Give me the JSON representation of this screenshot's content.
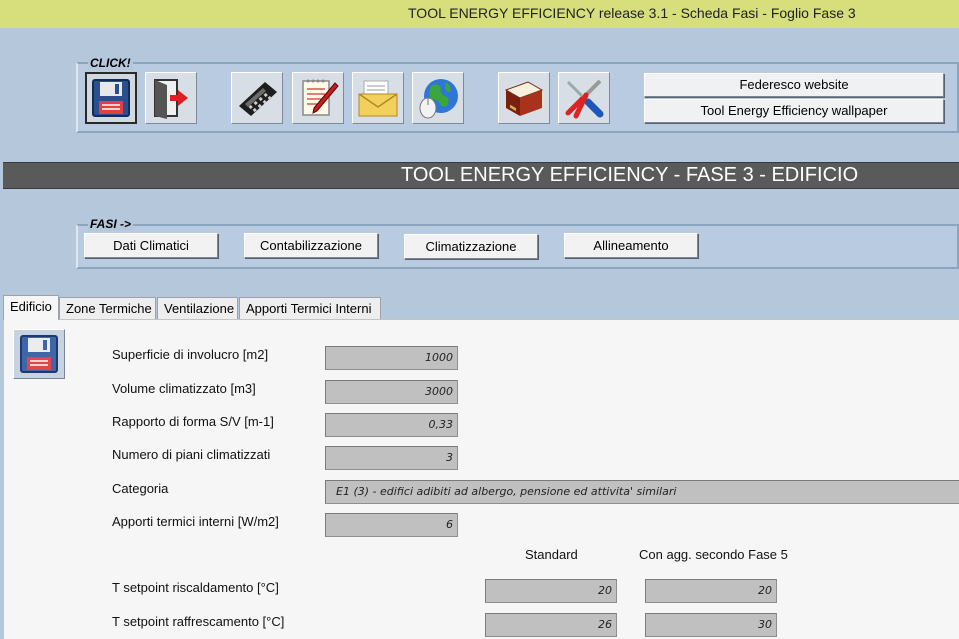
{
  "window": {
    "title": "TOOL ENERGY EFFICIENCY release 3.1 - Scheda Fasi - Foglio Fase 3"
  },
  "toolbar": {
    "group_label": "CLICK!",
    "icons": {
      "save": "floppy-disk-icon",
      "exit": "exit-door-icon",
      "calculator": "calculator-icon",
      "notes": "notepad-pencil-icon",
      "mail": "envelope-icon",
      "web": "globe-mouse-icon",
      "book": "book-icon",
      "tools": "screwdriver-pliers-icon"
    },
    "federesco_label": "Federesco website",
    "wallpaper_label": "Tool Energy Efficiency wallpaper"
  },
  "banner": {
    "title": "TOOL ENERGY EFFICIENCY - FASE 3 - EDIFICIO"
  },
  "phases": {
    "group_label": "FASI ->",
    "buttons": [
      "Dati Climatici",
      "Contabilizzazione",
      "Climatizzazione",
      "Allineamento"
    ]
  },
  "tabs": [
    "Edificio",
    "Zone Termiche",
    "Ventilazione",
    "Apporti Termici Interni"
  ],
  "form": {
    "superficie": {
      "label": "Superficie di involucro [m2]",
      "value": "1000"
    },
    "volume": {
      "label": "Volume climatizzato [m3]",
      "value": "3000"
    },
    "rapporto": {
      "label": "Rapporto di forma S/V [m-1]",
      "value": "0,33"
    },
    "piani": {
      "label": "Numero di piani climatizzati",
      "value": "3"
    },
    "categoria": {
      "label": "Categoria",
      "value": "E1 (3) - edifici adibiti ad albergo, pensione ed attivita' similari"
    },
    "apporti": {
      "label": "Apporti termici interni [W/m2]",
      "value": "6"
    },
    "columns": {
      "standard": "Standard",
      "aggiornato": "Con agg. secondo Fase 5"
    },
    "riscaldamento": {
      "label": "T setpoint riscaldamento [°C]",
      "standard": "20",
      "aggiornato": "20"
    },
    "raffrescamento": {
      "label": "T setpoint raffrescamento [°C]",
      "standard": "26",
      "aggiornato": "30"
    }
  }
}
